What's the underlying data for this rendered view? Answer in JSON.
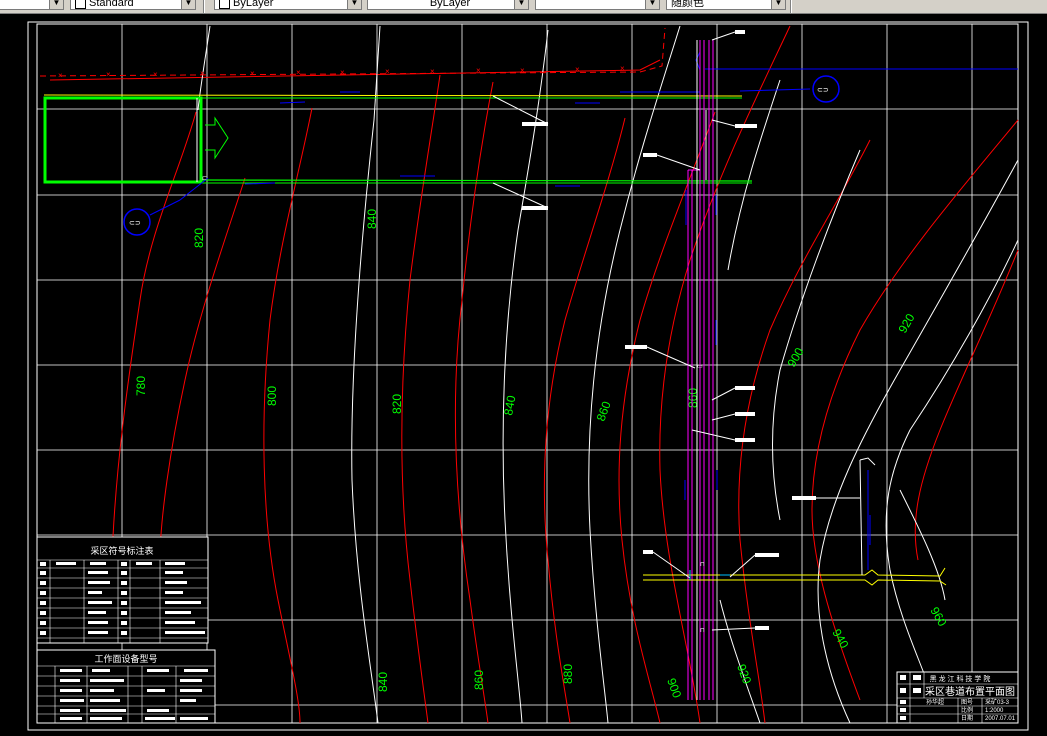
{
  "toolbar": {
    "text_style": "Standard",
    "linetype": "ByLayer",
    "lineweight": "ByLayer",
    "color": "随颜色"
  },
  "contours": {
    "labels_green": [
      "820",
      "840",
      "780",
      "800",
      "820",
      "840",
      "860",
      "860",
      "900",
      "920",
      "840",
      "860",
      "880",
      "900",
      "920",
      "940",
      "960"
    ]
  },
  "symbol_table": {
    "title": "采区符号标注表"
  },
  "equipment_table": {
    "title": "工作面设备型号"
  },
  "title_block": {
    "company": "黑 龙 江 科 技 学 院",
    "drawing_title": "采区巷道布置平面图",
    "drawing_no": "采矿03-3",
    "scale": "1:2000",
    "date": "2007.07.01",
    "col_scale_label": "比例",
    "col_date_label": "日期",
    "col_no_label": "图号",
    "designer": "孙华超"
  },
  "colors": {
    "grid": "#ffffff",
    "contour_red": "#ff0000",
    "contour_white": "#ffffff",
    "label": "#00ff00",
    "magenta": "#ff00ff",
    "blue": "#0000ff",
    "yellow": "#ffff00",
    "green_box": "#00ff00"
  }
}
